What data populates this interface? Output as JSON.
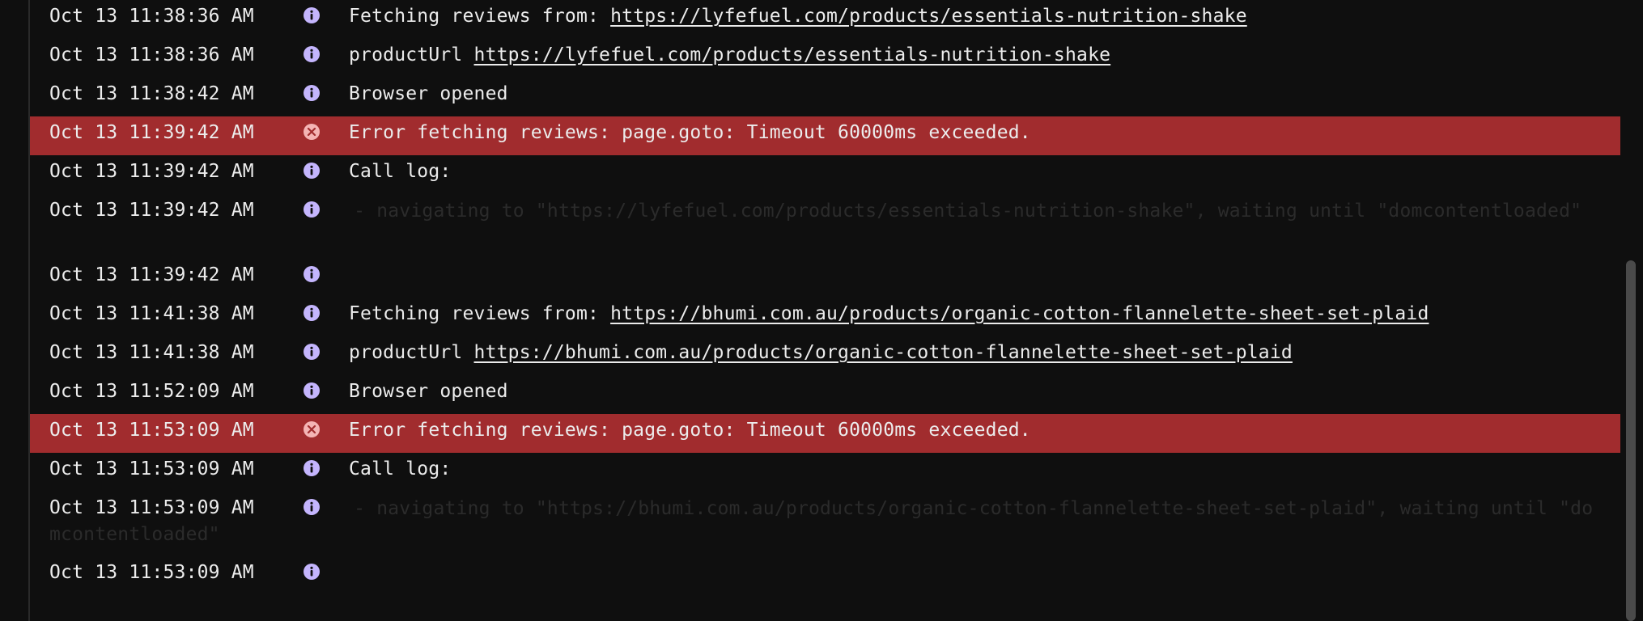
{
  "log": {
    "rows": [
      {
        "ts": "Oct 13 11:38:36 AM",
        "icon": "info-icon",
        "text": "Fetching reviews from: ",
        "link": "https://lyfefuel.com/products/essentials-nutrition-shake"
      },
      {
        "ts": "Oct 13 11:38:36 AM",
        "icon": "info-icon",
        "text": "productUrl ",
        "link": "https://lyfefuel.com/products/essentials-nutrition-shake"
      },
      {
        "ts": "Oct 13 11:38:42 AM",
        "icon": "info-icon",
        "text": "Browser opened"
      },
      {
        "ts": "Oct 13 11:39:42 AM",
        "icon": "error-icon",
        "text": "Error fetching reviews: page.goto: Timeout 60000ms exceeded."
      },
      {
        "ts": "Oct 13 11:39:42 AM",
        "icon": "info-icon",
        "text": "Call log:"
      },
      {
        "ts": "Oct 13 11:39:42 AM",
        "icon": "info-icon",
        "faded": "  - navigating to \"https://lyfefuel.com/products/essentials-nutrition-shake\", waiting until \"domcontentloaded\""
      },
      {
        "ts": "Oct 13 11:39:42 AM",
        "icon": "info-icon",
        "text": ""
      },
      {
        "ts": "Oct 13 11:41:38 AM",
        "icon": "info-icon",
        "text": "Fetching reviews from: ",
        "link": "https://bhumi.com.au/products/organic-cotton-flannelette-sheet-set-plaid"
      },
      {
        "ts": "Oct 13 11:41:38 AM",
        "icon": "info-icon",
        "text": "productUrl ",
        "link": "https://bhumi.com.au/products/organic-cotton-flannelette-sheet-set-plaid"
      },
      {
        "ts": "Oct 13 11:52:09 AM",
        "icon": "info-icon",
        "text": "Browser opened"
      },
      {
        "ts": "Oct 13 11:53:09 AM",
        "icon": "error-icon",
        "text": "Error fetching reviews: page.goto: Timeout 60000ms exceeded."
      },
      {
        "ts": "Oct 13 11:53:09 AM",
        "icon": "info-icon",
        "text": "Call log:"
      },
      {
        "ts": "Oct 13 11:53:09 AM",
        "icon": "info-icon",
        "faded": "  - navigating to \"https://bhumi.com.au/products/organic-cotton-flannelette-sheet-set-plaid\", waiting until \"domcontentloaded\""
      },
      {
        "ts": "Oct 13 11:53:09 AM",
        "icon": "info-icon",
        "text": ""
      }
    ]
  },
  "colors": {
    "background": "#0f0f0f",
    "error_row": "#a12c2e",
    "info_icon": "#c4b5fd",
    "error_icon": "#f4b4b4",
    "text": "#ececec"
  }
}
